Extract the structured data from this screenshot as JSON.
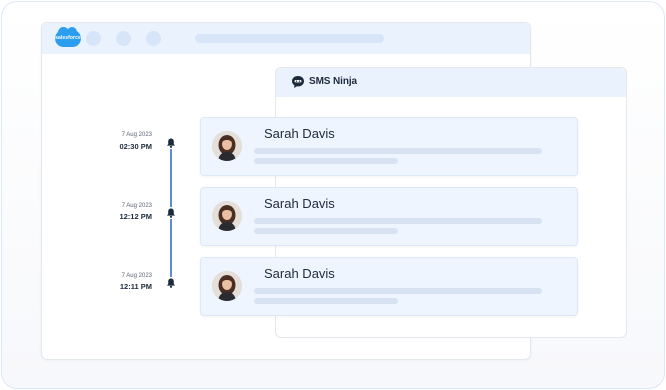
{
  "salesforce": {
    "logo_text": "salesforce",
    "icon": "salesforce-cloud-icon"
  },
  "sms_ninja": {
    "title": "SMS Ninja",
    "icon": "sms-ninja-logo-icon"
  },
  "timeline": [
    {
      "date": "7 Aug 2023",
      "time": "02:30 PM",
      "icon": "bell-icon"
    },
    {
      "date": "7 Aug 2023",
      "time": "12:12 PM",
      "icon": "bell-icon"
    },
    {
      "date": "7 Aug 2023",
      "time": "12:11 PM",
      "icon": "bell-icon"
    }
  ],
  "messages": [
    {
      "name": "Sarah Davis",
      "avatar": "avatar-icon"
    },
    {
      "name": "Sarah Davis",
      "avatar": "avatar-icon"
    },
    {
      "name": "Sarah Davis",
      "avatar": "avatar-icon"
    }
  ],
  "colors": {
    "header_bg": "#eaf2fd",
    "card_bg": "#eef5fe",
    "timeline": "#5e8cd0",
    "salesforce_blue": "#2b9ef0"
  }
}
